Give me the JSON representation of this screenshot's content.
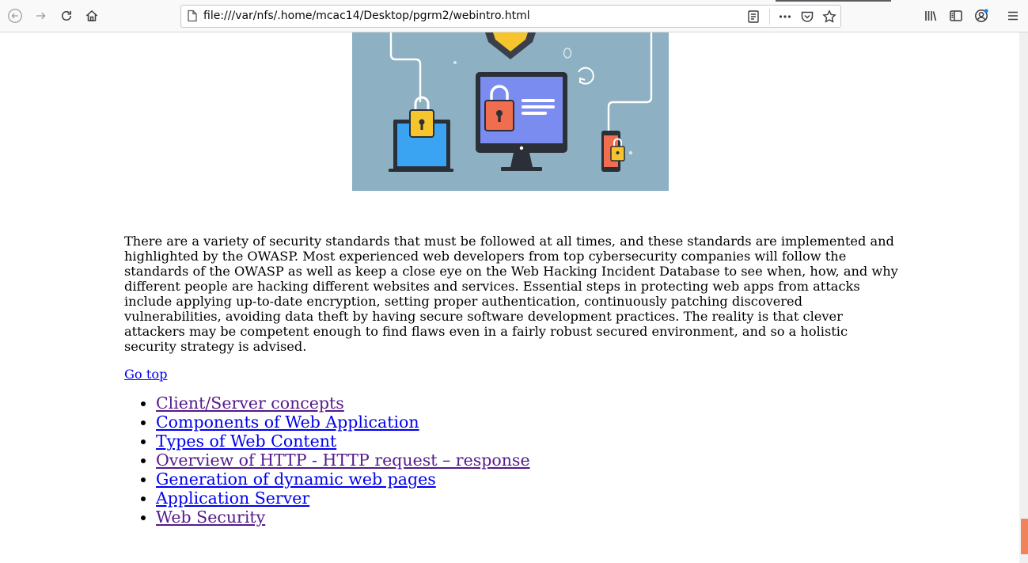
{
  "browser": {
    "url": "file:///var/nfs/.home/mcac14/Desktop/pgrm2/webintro.html",
    "icons": [
      "back-icon",
      "forward-icon",
      "reload-icon",
      "home-icon",
      "page-info-icon",
      "reader-view-icon",
      "page-actions-icon",
      "pocket-icon",
      "bookmark-star-icon",
      "library-icon",
      "sidebar-icon",
      "account-icon",
      "menu-icon"
    ]
  },
  "page": {
    "paragraph": "There are a variety of security standards that must be followed at all times, and these standards are implemented and highlighted by the OWASP. Most experienced web developers from top cybersecurity companies will follow the standards of the OWASP as well as keep a close eye on the Web Hacking Incident Database to see when, how, and why different people are hacking different websites and services. Essential steps in protecting web apps from attacks include applying up-to-date encryption, setting proper authentication, continuously patching discovered vulnerabilities, avoiding data theft by having secure software development practices. The reality is that clever attackers may be competent enough to find flaws even in a fairly robust secured environment, and so a holistic security strategy is advised.",
    "go_top": "Go top",
    "nav_links": [
      {
        "label": "Client/Server concepts",
        "visited": true
      },
      {
        "label": "Components of Web Application",
        "visited": false
      },
      {
        "label": "Types of Web Content",
        "visited": false
      },
      {
        "label": "Overview of HTTP - HTTP request – response",
        "visited": true
      },
      {
        "label": "Generation of dynamic web pages",
        "visited": false
      },
      {
        "label": "Application Server",
        "visited": false
      },
      {
        "label": "Web Security",
        "visited": true
      }
    ]
  },
  "colors": {
    "link": "#0000ee",
    "visited_link": "#551a8b",
    "hero_bg": "#8db0c2",
    "scroll_thumb": "#f0835a"
  }
}
